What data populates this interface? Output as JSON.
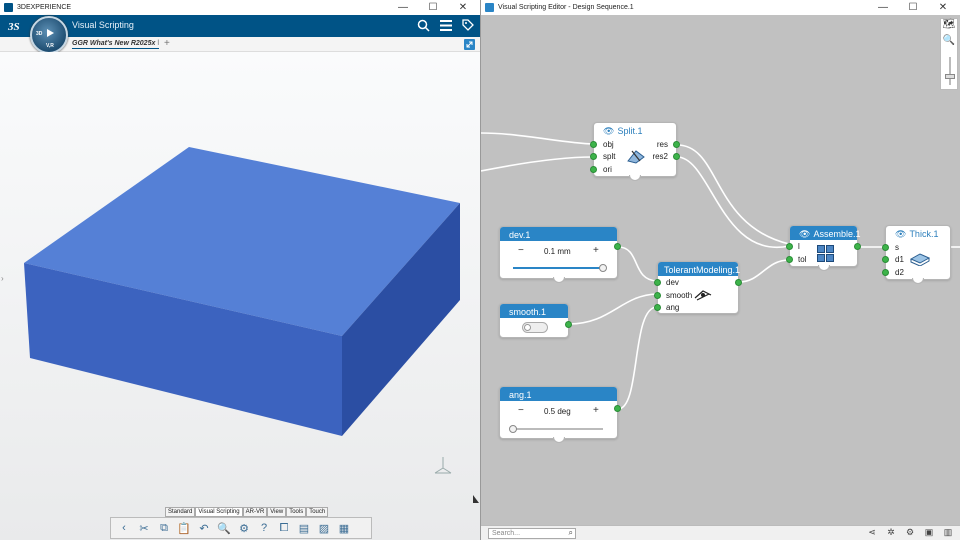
{
  "left_window": {
    "title": "3DEXPERIENCE",
    "app_title": "Visual Scripting",
    "compass": {
      "left_label": "3D",
      "bottom_label": "V,R"
    },
    "tab_label": "GGR What's New R2025x",
    "tab_overflow": "l",
    "toolbar_tabs": [
      "Standard",
      "Visual Scripting",
      "AR-VR",
      "View",
      "Tools",
      "Touch"
    ],
    "toolbar_tabs_active": "Visual Scripting",
    "box_color": "#4a74c8"
  },
  "right_window": {
    "title": "Visual Scripting Editor - Design Sequence.1",
    "search_placeholder": "Search...",
    "nodes": {
      "split": {
        "title": "Split.1",
        "inputs": [
          "obj",
          "splt",
          "ori"
        ],
        "outputs": [
          "res",
          "res2"
        ]
      },
      "dev": {
        "title": "dev.1",
        "value": "0.1 mm",
        "slider_fraction": 1.0
      },
      "smooth": {
        "title": "smooth.1"
      },
      "ang": {
        "title": "ang.1",
        "value": "0.5 deg",
        "slider_fraction": 0.0
      },
      "tolerant": {
        "title": "TolerantModeling.1",
        "inputs": [
          "dev",
          "smooth",
          "ang"
        ]
      },
      "assemble": {
        "title": "Assemble.1",
        "inputs": [
          "l",
          "tol"
        ]
      },
      "thick": {
        "title": "Thick.1",
        "inputs": [
          "s",
          "d1",
          "d2"
        ]
      }
    },
    "minus": "−",
    "plus": "+",
    "colors": {
      "canvas": "#c1c1c1",
      "node_header": "#2a85c6",
      "port": "#3db34a",
      "wire": "#ffffff"
    }
  },
  "window_controls": {
    "min": "—",
    "max": "☐",
    "close": "✕"
  }
}
